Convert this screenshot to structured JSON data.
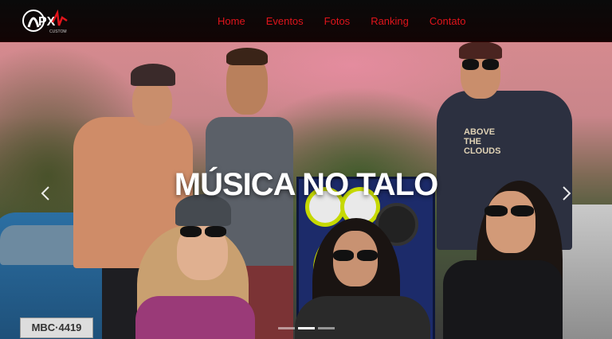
{
  "brand": {
    "logo_text": "PX",
    "logo_sub": "CUSTOM"
  },
  "nav": {
    "items": [
      {
        "label": "Home"
      },
      {
        "label": "Eventos"
      },
      {
        "label": "Fotos"
      },
      {
        "label": "Ranking"
      },
      {
        "label": "Contato"
      }
    ]
  },
  "hero": {
    "title": "MÚSICA NO TALO",
    "prev_icon": "chevron-left-icon",
    "next_icon": "chevron-right-icon",
    "slides_total": 3,
    "slide_active": 2,
    "shirt_text": "ABOVE THE CLOUDS",
    "plate": "MBC·4419"
  },
  "colors": {
    "nav_link": "#e0141b",
    "topbar": "#0a0a0a"
  }
}
